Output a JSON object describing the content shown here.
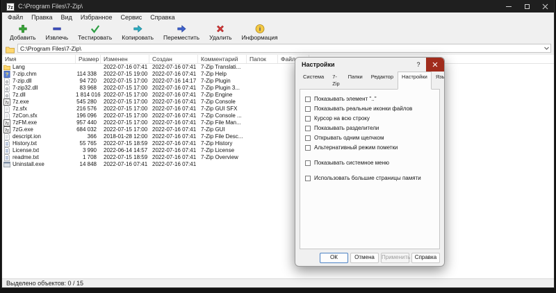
{
  "colors": {
    "titlebar_bg": "#1f1f1f",
    "chrome_bg": "#f0f0f0",
    "list_bg": "#ffffff",
    "dialog_close_red": "#a02c1c",
    "add_green": "#3aa63a",
    "extract_blue": "#3f51c1",
    "copy_teal": "#2fb0c4",
    "move_blue": "#3f63cd",
    "delete_red": "#d93a3a",
    "info_gold": "#f4c942",
    "folder_yellow": "#ffd76e"
  },
  "titlebar": {
    "title": "C:\\Program Files\\7-Zip\\",
    "app_icon": "7zip-logo-icon"
  },
  "menubar": {
    "items": [
      {
        "label": "Файл",
        "name": "menu-item-file"
      },
      {
        "label": "Правка",
        "name": "menu-item-edit"
      },
      {
        "label": "Вид",
        "name": "menu-item-view"
      },
      {
        "label": "Избранное",
        "name": "menu-item-favorites"
      },
      {
        "label": "Сервис",
        "name": "menu-item-tools"
      },
      {
        "label": "Справка",
        "name": "menu-item-help"
      }
    ]
  },
  "toolbar": {
    "items": [
      {
        "label": "Добавить",
        "name": "add-button",
        "icon": "add-icon"
      },
      {
        "label": "Извлечь",
        "name": "extract-button",
        "icon": "extract-icon"
      },
      {
        "label": "Тестировать",
        "name": "test-button",
        "icon": "test-icon"
      },
      {
        "label": "Копировать",
        "name": "copy-button",
        "icon": "copy-icon"
      },
      {
        "label": "Переместить",
        "name": "move-button",
        "icon": "move-icon"
      },
      {
        "label": "Удалить",
        "name": "delete-button",
        "icon": "delete-icon"
      },
      {
        "label": "Информация",
        "name": "info-button",
        "icon": "info-icon"
      }
    ]
  },
  "addressbar": {
    "path": "C:\\Program Files\\7-Zip\\"
  },
  "filelist": {
    "columns": [
      "Имя",
      "Размер",
      "Изменен",
      "Создан",
      "Комментарий",
      "Папок",
      "Файлов"
    ],
    "column_names": [
      "name",
      "size",
      "modified",
      "created",
      "comment",
      "folders",
      "files"
    ],
    "rows": [
      {
        "icon": "folder",
        "name": "Lang",
        "size": "",
        "modified": "2022-07-16 07:41",
        "created": "2022-07-16 07:41",
        "comment": "7-Zip Translati...",
        "folders": "",
        "files": ""
      },
      {
        "icon": "help",
        "name": "7-zip.chm",
        "size": "114 338",
        "modified": "2022-07-15 19:00",
        "created": "2022-07-16 07:41",
        "comment": "7-Zip Help",
        "folders": "",
        "files": ""
      },
      {
        "icon": "dll",
        "name": "7-zip.dll",
        "size": "94 720",
        "modified": "2022-07-15 17:00",
        "created": "2022-07-16 14:17",
        "comment": "7-Zip Plugin",
        "folders": "",
        "files": ""
      },
      {
        "icon": "dll",
        "name": "7-zip32.dll",
        "size": "83 968",
        "modified": "2022-07-15 17:00",
        "created": "2022-07-16 07:41",
        "comment": "7-Zip Plugin 3...",
        "folders": "",
        "files": ""
      },
      {
        "icon": "dll",
        "name": "7z.dll",
        "size": "1 814 016",
        "modified": "2022-07-15 17:00",
        "created": "2022-07-16 07:41",
        "comment": "7-Zip Engine",
        "folders": "",
        "files": ""
      },
      {
        "icon": "exe7z",
        "name": "7z.exe",
        "size": "545 280",
        "modified": "2022-07-15 17:00",
        "created": "2022-07-16 07:41",
        "comment": "7-Zip Console",
        "folders": "",
        "files": ""
      },
      {
        "icon": "page",
        "name": "7z.sfx",
        "size": "216 576",
        "modified": "2022-07-15 17:00",
        "created": "2022-07-16 07:41",
        "comment": "7-Zip GUI SFX",
        "folders": "",
        "files": ""
      },
      {
        "icon": "page",
        "name": "7zCon.sfx",
        "size": "196 096",
        "modified": "2022-07-15 17:00",
        "created": "2022-07-16 07:41",
        "comment": "7-Zip Console ...",
        "folders": "",
        "files": ""
      },
      {
        "icon": "exe7z",
        "name": "7zFM.exe",
        "size": "957 440",
        "modified": "2022-07-15 17:00",
        "created": "2022-07-16 07:41",
        "comment": "7-Zip File Man...",
        "folders": "",
        "files": ""
      },
      {
        "icon": "exe7z",
        "name": "7zG.exe",
        "size": "684 032",
        "modified": "2022-07-15 17:00",
        "created": "2022-07-16 07:41",
        "comment": "7-Zip GUI",
        "folders": "",
        "files": ""
      },
      {
        "icon": "page",
        "name": "descript.ion",
        "size": "366",
        "modified": "2018-01-28 12:00",
        "created": "2022-07-16 07:41",
        "comment": "7-Zip File Desc...",
        "folders": "",
        "files": ""
      },
      {
        "icon": "txt",
        "name": "History.txt",
        "size": "55 765",
        "modified": "2022-07-15 18:59",
        "created": "2022-07-16 07:41",
        "comment": "7-Zip History",
        "folders": "",
        "files": ""
      },
      {
        "icon": "txt",
        "name": "License.txt",
        "size": "3 990",
        "modified": "2022-06-14 14:57",
        "created": "2022-07-16 07:41",
        "comment": "7-Zip License",
        "folders": "",
        "files": ""
      },
      {
        "icon": "txt",
        "name": "readme.txt",
        "size": "1 708",
        "modified": "2022-07-15 18:59",
        "created": "2022-07-16 07:41",
        "comment": "7-Zip Overview",
        "folders": "",
        "files": ""
      },
      {
        "icon": "setup",
        "name": "Uninstall.exe",
        "size": "14 848",
        "modified": "2022-07-16 07:41",
        "created": "2022-07-16 07:41",
        "comment": "",
        "folders": "",
        "files": ""
      }
    ]
  },
  "statusbar": {
    "text": "Выделено объектов: 0 / 15"
  },
  "dialog": {
    "title": "Настройки",
    "help_glyph": "?",
    "active_tab": "Настройки",
    "tabs": [
      {
        "label": "Система",
        "name": "tab-system"
      },
      {
        "label": "7-Zip",
        "name": "tab-7zip"
      },
      {
        "label": "Папки",
        "name": "tab-folders"
      },
      {
        "label": "Редактор",
        "name": "tab-editor"
      },
      {
        "label": "Настройки",
        "name": "tab-settings"
      },
      {
        "label": "Язык",
        "name": "tab-language"
      }
    ],
    "options": [
      {
        "label": "Показывать элемент \"..\"",
        "name": "option-show-dotdot-item",
        "checked": false,
        "gap": false
      },
      {
        "label": "Показывать реальные иконки файлов",
        "name": "option-show-real-file-icons",
        "checked": false,
        "gap": false
      },
      {
        "label": "Курсор на всю строку",
        "name": "option-full-row-select",
        "checked": false,
        "gap": false
      },
      {
        "label": "Показывать разделители",
        "name": "option-show-grid-lines",
        "checked": false,
        "gap": false
      },
      {
        "label": "Открывать одним щелчком",
        "name": "option-single-click-open",
        "checked": false,
        "gap": false
      },
      {
        "label": "Альтернативный режим пометки",
        "name": "option-alternative-selection",
        "checked": false,
        "gap": false
      },
      {
        "label": "Показывать системное меню",
        "name": "option-show-system-menu",
        "checked": false,
        "gap": true
      },
      {
        "label": "Использовать большие страницы памяти",
        "name": "option-use-large-memory-pages",
        "checked": false,
        "gap": true
      }
    ],
    "buttons": [
      {
        "label": "ОК",
        "name": "ok-button",
        "disabled": false,
        "default": true
      },
      {
        "label": "Отмена",
        "name": "cancel-button",
        "disabled": false,
        "default": false
      },
      {
        "label": "Применить",
        "name": "apply-button",
        "disabled": true,
        "default": false
      },
      {
        "label": "Справка",
        "name": "help-button",
        "disabled": false,
        "default": false
      }
    ]
  }
}
